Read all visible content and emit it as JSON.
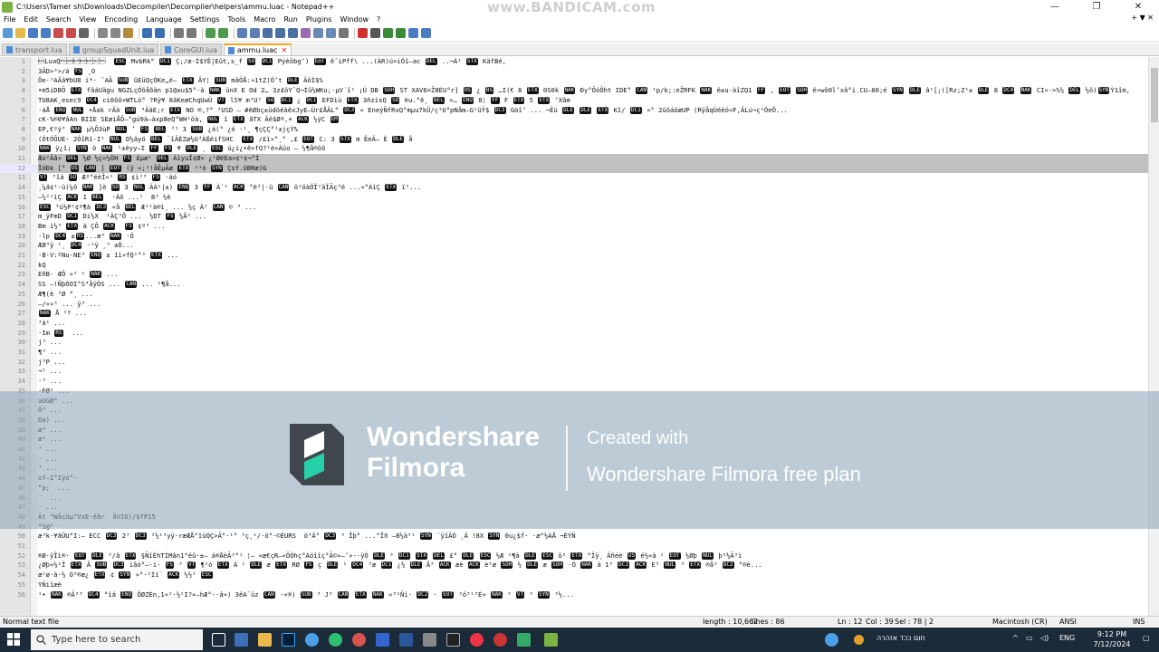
{
  "window": {
    "title": "C:\\Users\\Tamer sh\\Downloads\\Decompiler\\Decompiler\\helpers\\ammu.luac - Notepad++",
    "recorder_overlay": "www.BANDICAM.com",
    "controls": [
      "—",
      "❐",
      "✕"
    ]
  },
  "menu": {
    "items": [
      "File",
      "Edit",
      "Search",
      "View",
      "Encoding",
      "Language",
      "Settings",
      "Tools",
      "Macro",
      "Run",
      "Plugins",
      "Window",
      "?"
    ],
    "right": "+ ▼ ✕"
  },
  "tabs": [
    {
      "label": "transport.lua",
      "active": false
    },
    {
      "label": "groupSquadUnit.lua",
      "active": false
    },
    {
      "label": "CoreGUI.lua",
      "active": false
    },
    {
      "label": "ammu.luac",
      "active": true
    }
  ],
  "editor": {
    "current_line": 12,
    "lines": [
      {
        "n": "1",
        "t": "\u001bLuaQ\u0000\u0001\u0004\u0004\u0004\b\u0000  ESC MvbRk° DC1 Ç;/æ-Ì$ÝË|Eût,s_f SO DC1 Pýèöbg’) EOT êˆiPff\\ ...(ÀR)ú×iÓî–ac DEL ..¬À¹ STX KäfBé,"
      },
      {
        "n": "2",
        "t": "3ÄD>³>/á FS ¸O"
      },
      {
        "n": "3",
        "t": "Öe·¹AÄä¥bU8 i*· ˆAÄ SUB ûEüQçÓKe„é– ETX ÂY¦ SUB mâÒÅ:»1tZ(Ó’t DLE ÄöÍ$%"
      },
      {
        "n": "4",
        "t": "•m5iDBÕ ETX fâáUägu NGZLçÓõåõän p1@±u$5°·à NAK ünX E Od 2… 3z£öYˆQ¬Íü½WKu;·µV´î¹ ¡Ú DB SOH ST XAV6=Ž8ÉU°r] US ¿ BS …I(€ 8 ETX 0S0k NAK Ðy°ÔóÔht IDE° CAN ¹p/k;:eŽRFK NAK ë±u·àîZQ1 FF , EOT SOH ë»wô0l’xâ°i.CU–00;é SYN DLE â¹[;([Rz;Z¹± DLE 8 DC4 NAK CI«->%½ DEL ½ö)SYNÝ1îm,"
      },
      {
        "n": "5",
        "t": "TU8AK¸esec9 DC4 ci0ôõ×WTLó° ?Rÿ¥ 8âKeæChqUwÙ VT lS¥ m³U² SO DC1 ¿ DC1 EFDìù ETX 3ñzìsQ SO èu.°ê¸ BEL »… ENQ 8¦ FF F ETX 5 ETX ’Xâm"
      },
      {
        "n": "6",
        "t": "·áÅ ENQ NUL •Åak rÂà SUB ³ÂäE;r ETX NO ®,?° ³USD — #êØbç±üdöéàëxJyE–Ùr£ÅÄL° DC3 « EneýÑfRxQ°mµu7kÜ/ç¹U°pNåm–G¹üŸ$ DC3 Gòî’ ... ¬Ëú DLE DLE ETX Kî/ DC1 »° 2üöáöæUP (RÿåqÙéèó<F,ÂLú¬ç²ÓeÔ..."
      },
      {
        "n": "7",
        "t": "cK-%®0¥âAn BIIE SEæiÅÖ—°gú9à–àxp8eQ°WH¹öà, NUL î ETX ãTX Äë$Øª,+ ACK ½ÿC EM"
      },
      {
        "n": "8",
        "t": "EP,€ºý³ NAK µ½Õ3ùP NUL ’ FS BEL ³¹ 3 SUB ¿á(° ¿ó ·¹­¸ ¶çÇÇ°¹±jçÝ%"
      },
      {
        "n": "9",
        "t": "(ÓtÓÕUE· 2ÓîRî·I¹ NUL D½äyö BEL ¨îÄÉZø½U³ÀßéifSHC  ETX /£ì»°­¸° ,£ EOT C: 3 STX m ËeÄ– È DLE å"
      },
      {
        "n": "10",
        "t": "NAK ÿ¿î¡ SYN ö NAK ¹±èyy–I FF FS ¥ DLE ¸ ESC ú¿i¿•ë»fQ?¹è»Àüo – ½¶å®öô­"
      },
      {
        "n": "11",
        "t": "Æo²Ãâ» DEL ½Ø ½ç«½ÒH FS £µæ¹ DEL ÀìyuÎ¢Ø» ¿¹ØëEa»¢¹¢¬°Í"
      },
      {
        "n": "12",
        "t": "ÏöÐk [° US CAN ] EOT (ÿ «;¹!åÊµÃæ ETX ²¹­ó SYN ÇsÝ.ûBRæ)G"
      },
      {
        "n": "13",
        "t": "VT ³îá SO Æº°éèÎ«¹ RS ¢ì²³ FS ·áó"
      },
      {
        "n": "14",
        "t": "¸¼ä¢¹·ü(¼ô NAK ]è SO 3 NUL ÄÀ¹|±) ENQ 3 FF À´¹ ACK °è³|·ü CAN ö¹öàÓÏ²äÏÃç³é ...»°ÁìÇ ETX ï²..."
      },
      {
        "n": "15",
        "t": "–½²¹ìÇ ACK 1 BEL  ·Àô ...¹  8³ ½è"
      },
      {
        "n": "16",
        "t": "ESC ³ú½P²¢º¶à DC3 «å BEL Æ²¹à®ì¸ ... ½ç À¹ CAN © ³ ..."
      },
      {
        "n": "17",
        "t": "m_ÿFmD DC1 Di½X  ¹ÀÇ³Ô ...  ½DT FS ½Â² ..."
      },
      {
        "n": "18",
        "t": "Bm ì½³ ETX à ÇÔ ACK  FS ¢º³ ..."
      },
      {
        "n": "19",
        "t": "·lp DC4 ±RS...æ³ NAK ·Ó"
      },
      {
        "n": "20",
        "t": "ÆØ³ÿ ¹¸ DC4 ·¹ÿ ¸³ ±Ó..."
      },
      {
        "n": "21",
        "t": "·B·V:ºNu·NE³ ENQ ± 1ì»fQ¹°³ ETX ..."
      },
      {
        "n": "22",
        "t": "kQ"
      },
      {
        "n": "23",
        "t": "EñB· ÆÔ «² ¹ NAK ..."
      },
      {
        "n": "24",
        "t": "SS –!ÑþðOI°S³åÿÒS ... CAN ... ¹¶å..."
      },
      {
        "n": "25",
        "t": "Æ¶(è ³Ø °¸ ... "
      },
      {
        "n": "26",
        "t": "–/«»³ ... ÿ³ ..."
      },
      {
        "n": "27",
        "t": "NAK Å ¹º ..."
      },
      {
        "n": "28",
        "t": "³à¹ ..."
      },
      {
        "n": "29",
        "t": "·Im RS  ..."
      },
      {
        "n": "30",
        "t": "j³ ..."
      },
      {
        "n": "31",
        "t": "¶³ ..."
      },
      {
        "n": "32",
        "t": "j³P ..."
      },
      {
        "n": "33",
        "t": "¬¹ ..."
      },
      {
        "n": "34",
        "t": "·³ ..."
      },
      {
        "n": "35",
        "t": "·FØ¹ ..."
      },
      {
        "n": "36",
        "t": "aUGØ° ..."
      },
      {
        "n": "37",
        "t": "Ó³ ..."
      },
      {
        "n": "38",
        "t": "Da) ..."
      },
      {
        "n": "39",
        "t": "æ³ ..."
      },
      {
        "n": "40",
        "t": "æ¹ ..."
      },
      {
        "n": "41",
        "t": "³ ..."
      },
      {
        "n": "42",
        "t": "· ..."
      },
      {
        "n": "43",
        "t": "³ ..."
      },
      {
        "n": "44",
        "t": "of–I°Iÿó°·"
      },
      {
        "n": "45",
        "t": "“p;  ..."
      },
      {
        "n": "46",
        "t": "¨  ..."
      },
      {
        "n": "47",
        "t": "· ..."
      },
      {
        "n": "48",
        "t": "Ãt °Wåçóµ°VxE·êãr  åVIO)/$fP15"
      },
      {
        "n": "49",
        "t": "°S@°"
      },
      {
        "n": "50",
        "t": "æ³k·¥ãÛU°I:— ECC DC3 2³ DC3 ³½¹³yÿ·ræÆÅ°îüQÇ>Ã°·¹° ³ç¸¹­/·ö°·©ÉURS  ö³Â° DC3 ³ Îþ° ...°Îñ –8½ä³¹ SYN ¨ÿîÄÓ ¸Ä !8X SYN 0u¿$f· ·æ°½AÅ ¬ÈÝÑ"
      },
      {
        "n": "51",
        "t": ""
      },
      {
        "n": "52",
        "t": "®Ø·ÿÎì®· EOT DLE ³/ã ETX §ÑîÈhTÍMân1°ëû·±– á®ÅèÃ³°¹ ¦— «æ€çR–«ÖÓhç°Àóîîç°Ã©»–’»-·ÿÓ DLE ³ DC1 STX DEL £° DLE ESC ½Æ ¹¶à DLE ESC ö³ ETX °Ïÿ¸ Äñéè US é½«à ² EOT ½Øþ NUL þ³½Ã³ì"
      },
      {
        "n": "53",
        "t": "¿Øþ»½¹Ï ETX Â SUB DC3 ìâó°–·í· FS ³ VT ¶²ó ETX À ¹ DLE æ ETX RØ FS ç DLE ¹ DC4 ³æ DC1 ¿½ DLE Â³ ACK æè ACK è¹æ SOH ½ DLE æ SOH ·Ó NAK à 1³ DC1 ACK E³ NUL ³ ETX ®å³ DC2 °®è..."
      },
      {
        "n": "54",
        "t": "æ²ø·à·½ O³®æ¿ ETX ¢ SYN »°·¹Íí¨ ACK ½½³ ESC"
      },
      {
        "n": "55",
        "t": "YÑiïæè"
      },
      {
        "n": "56",
        "t": "¹• NAK ®Ã³³ DC4 °îá ENQ ÔØZÈn,1«²·½²I?«–hÆ°··â») 3ëA¨üz CAN ·«®) SUB ³ J³ CAN ETX NAK «³¹Ñì· DC2 · EOT ³ô³¹³É» NAK ³ VT ³ SYN ³½..."
      }
    ]
  },
  "watermark": {
    "brand_line1": "Wondershare",
    "brand_line2": "Filmora",
    "created": "Created with",
    "plan": "Wondershare Filmora free plan"
  },
  "status": {
    "type": "Normal text file",
    "length": "length : 10,662",
    "lines": "lines : 86",
    "pos": "Ln : 12",
    "col": "Col : 39",
    "sel": "Sel : 78 | 2",
    "eol": "Macintosh (CR)",
    "enc": "ANSI",
    "ins": "INS"
  },
  "taskbar": {
    "search_placeholder": "Type here to search",
    "tray_text": "חום ככד אזהרה",
    "lang": "ENG",
    "time": "9:12 PM",
    "date": "7/12/2024"
  }
}
